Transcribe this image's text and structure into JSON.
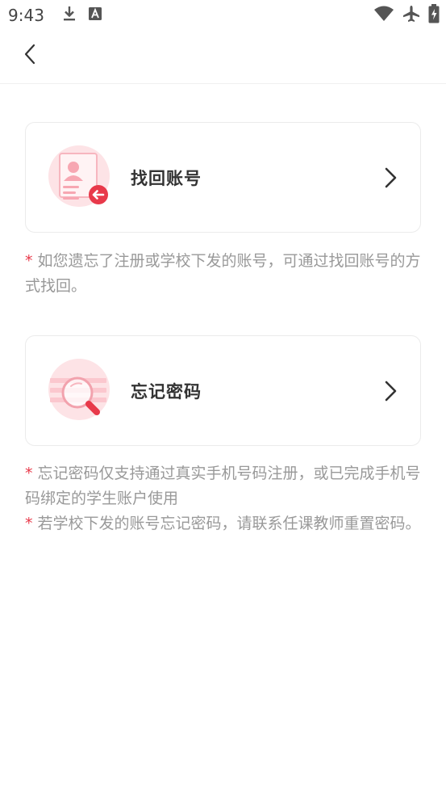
{
  "status_bar": {
    "time": "9:43",
    "left_icons": [
      "download-icon",
      "text-a-icon"
    ],
    "right_icons": [
      "wifi-icon",
      "airplane-icon",
      "battery-charging-icon"
    ]
  },
  "nav": {
    "back_icon": "chevron-left-icon"
  },
  "accent_color": "#e8394a",
  "cards": [
    {
      "title": "找回账号",
      "icon": "id-card-return-icon"
    },
    {
      "title": "忘记密码",
      "icon": "search-magnifier-icon"
    }
  ],
  "notes": {
    "star": "*",
    "account_note": "如您遗忘了注册或学校下发的账号，可通过找回账号的方式找回。",
    "password_note_1": "忘记密码仅支持通过真实手机号码注册，或已完成手机号码绑定的学生账户使用",
    "password_note_2": "若学校下发的账号忘记密码，请联系任课教师重置密码。"
  }
}
